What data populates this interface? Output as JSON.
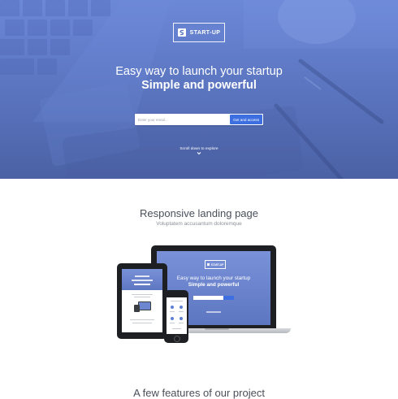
{
  "hero": {
    "brand": "START-UP",
    "title": "Easy way to launch your startup",
    "subtitle": "Simple and powerful",
    "email_placeholder": "Enter your email...",
    "cta_label": "Get and access",
    "scroll_label": "Scroll down to explore"
  },
  "section_devices": {
    "title": "Responsive landing page",
    "subtitle": "Voluptatem accusantum doloremque",
    "mockup": {
      "brand": "START-UP",
      "title": "Easy way to launch your startup",
      "subtitle": "Simple and powerful"
    }
  },
  "section_features": {
    "title": "A few features of our project"
  },
  "colors": {
    "hero_blue": "#5d76c1",
    "accent": "#3d6fe0",
    "text_dark": "#4a4f5a",
    "text_muted": "#8a8f98"
  },
  "icons": {
    "logo": "s-logo-icon",
    "scroll": "chevron-down-icon"
  }
}
